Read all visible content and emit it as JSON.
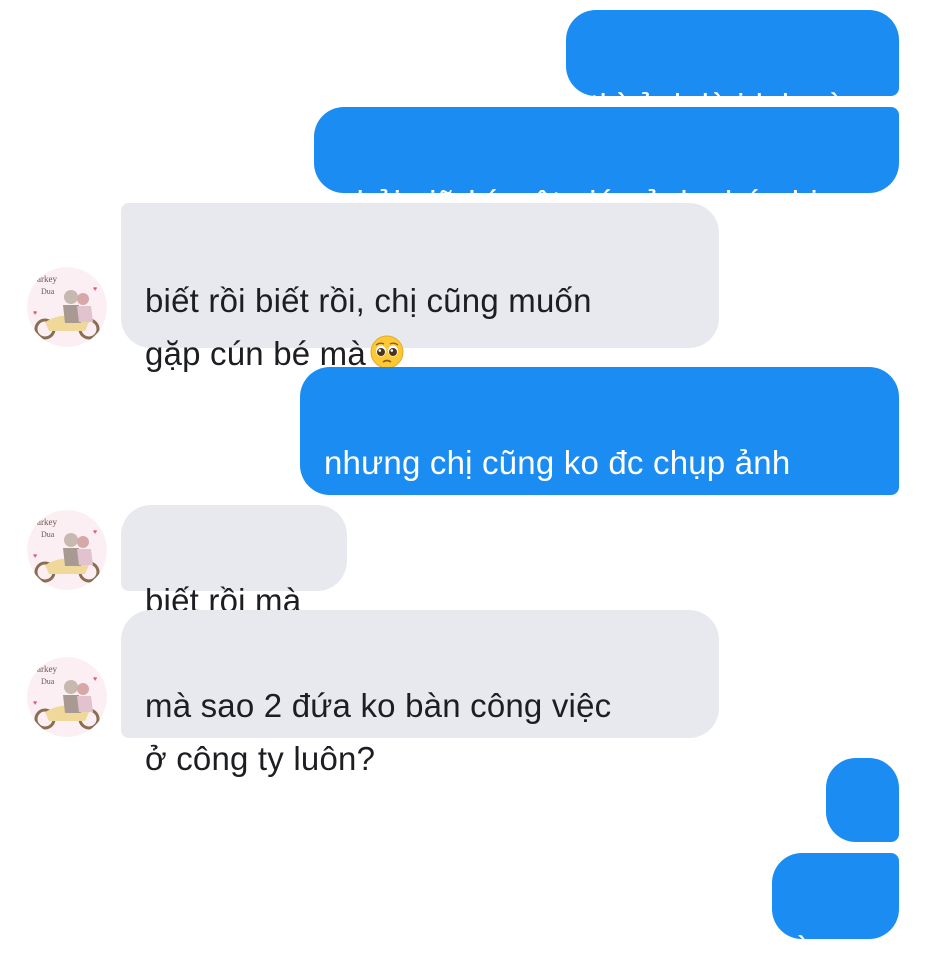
{
  "messages": [
    {
      "text": "thì ảnh là idol mà"
    },
    {
      "text": "phải giữ bí mật giúp ảnh chứ chị"
    },
    {
      "text": "biết rồi biết rồi, chị cũng muốn\ngặp cún bé mà",
      "emoji": "pleading-face-icon"
    },
    {
      "text": "nhưng chị cũng ko đc chụp ảnh\nnữa nhé?"
    },
    {
      "text": "biết rồi mà"
    },
    {
      "text": "mà sao 2 đứa ko bàn công việc\nở công ty luôn?"
    },
    {
      "text": "..."
    },
    {
      "text": "ờm..."
    }
  ],
  "avatar": {
    "lines": [
      "arkey",
      "Dua"
    ]
  },
  "colors": {
    "sent_bubble": "#1a8cf2",
    "received_bubble": "#e7e9ee",
    "received_text": "#1c1e21"
  }
}
